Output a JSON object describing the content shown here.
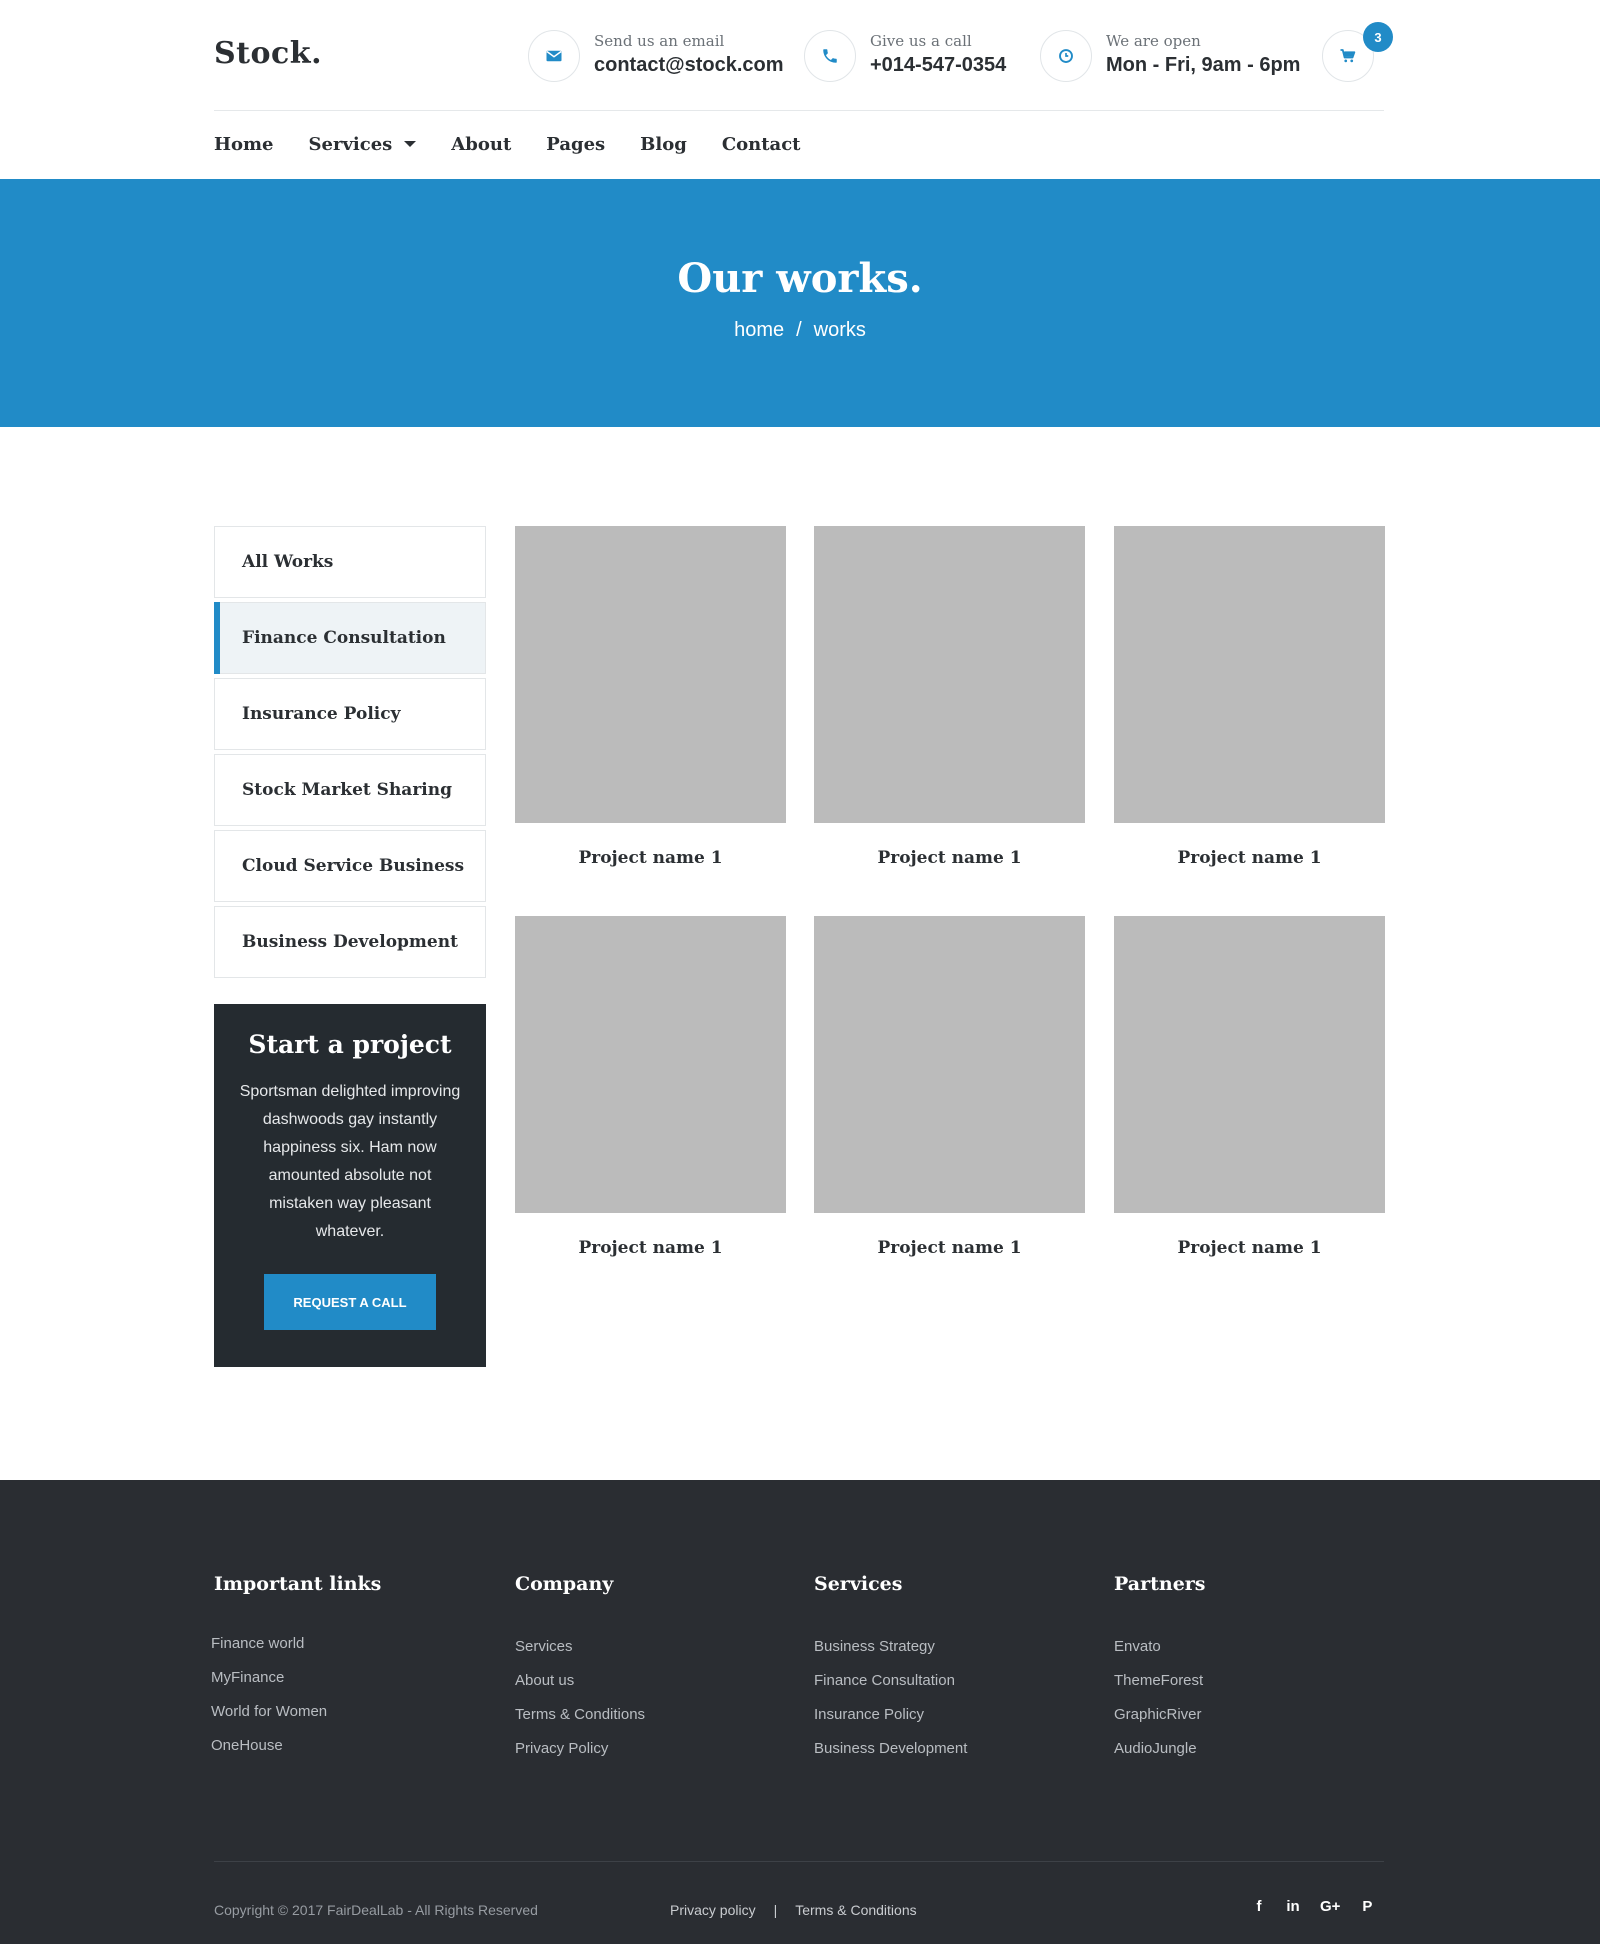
{
  "brand": {
    "logo": "Stock."
  },
  "contacts": {
    "email": {
      "label": "Send us an email",
      "value": "contact@stock.com",
      "icon": "envelope-icon"
    },
    "phone": {
      "label": "Give us a call",
      "value": "+014-547-0354",
      "icon": "phone-icon"
    },
    "hours": {
      "label": "We are open",
      "value": "Mon - Fri, 9am - 6pm",
      "icon": "clock-icon"
    }
  },
  "cart": {
    "count": "3",
    "icon": "cart-icon"
  },
  "nav": [
    "Home",
    "Services",
    "About",
    "Pages",
    "Blog",
    "Contact"
  ],
  "hero": {
    "title": "Our works.",
    "breadcrumb": [
      "home",
      "/",
      "works"
    ]
  },
  "categories": {
    "items": [
      "All Works",
      "Finance Consultation",
      "Insurance Policy",
      "Stock Market Sharing",
      "Cloud Service Business",
      "Business Development"
    ],
    "active": "Finance Consultation"
  },
  "project_card": {
    "title": "Start a project",
    "text": "Sportsman delighted improving dashwoods gay instantly happiness six. Ham now amounted absolute not mistaken way pleasant whatever.",
    "button": "REQUEST A CALL"
  },
  "works": [
    "Project name 1",
    "Project name 1",
    "Project name 1",
    "Project name 1",
    "Project name 1",
    "Project name 1"
  ],
  "footer": {
    "columns": [
      {
        "title": "Important links",
        "links": [
          "Finance world",
          "MyFinance",
          "World for Women",
          "OneHouse"
        ]
      },
      {
        "title": "Company",
        "links": [
          "Services",
          "About us",
          "Terms & Conditions",
          "Privacy Policy"
        ]
      },
      {
        "title": "Services",
        "links": [
          "Business Strategy",
          "Finance Consultation",
          "Insurance Policy",
          "Business Development"
        ]
      },
      {
        "title": "Partners",
        "links": [
          "Envato",
          "ThemeForest",
          "GraphicRiver",
          "AudioJungle"
        ]
      }
    ],
    "copyright": "Copyright © 2017 FairDealLab - All Rights Reserved",
    "bottom_links": [
      "Privacy policy",
      "|",
      "Terms & Conditions"
    ],
    "social": [
      {
        "icon": "facebook-icon",
        "glyph": "f"
      },
      {
        "icon": "linkedin-icon",
        "glyph": "in"
      },
      {
        "icon": "google-plus-icon",
        "glyph": "G+"
      },
      {
        "icon": "pinterest-icon",
        "glyph": "P"
      }
    ]
  },
  "colors": {
    "accent": "#218bc7",
    "dark": "#252b30",
    "footer": "#2a2d32",
    "placeholder": "#bbbbbb"
  }
}
